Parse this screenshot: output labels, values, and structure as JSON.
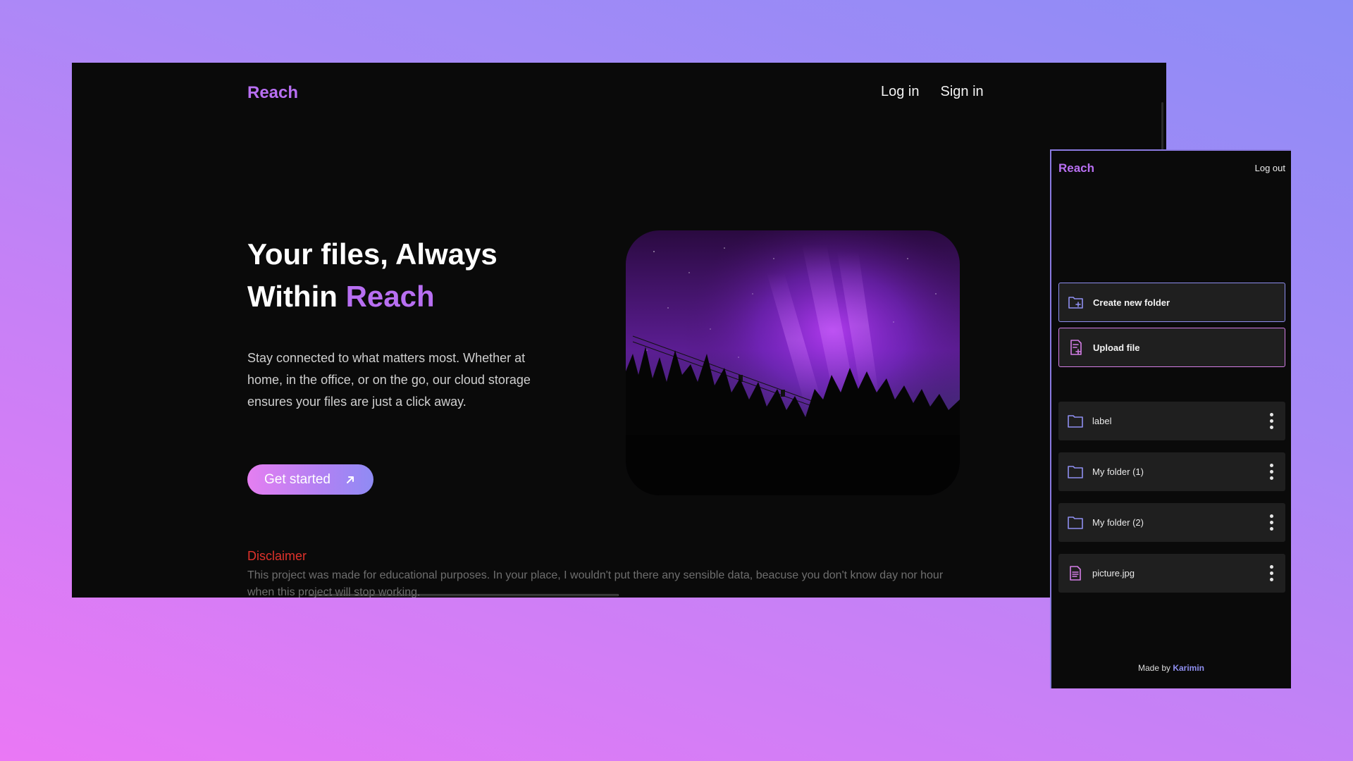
{
  "desktop": {
    "logo": "Reach",
    "nav": {
      "login": "Log in",
      "signin": "Sign in"
    },
    "hero": {
      "title_line1": "Your files, Always",
      "title_line2_prefix": "Within ",
      "title_line2_accent": "Reach",
      "text": "Stay connected to what matters most. Whether at home, in the office, or on the go, our cloud storage ensures your files are just a click away.",
      "cta_label": "Get started",
      "cta_icon": "arrow-up-right-icon"
    },
    "disclaimer": {
      "title": "Disclaimer",
      "text": "This project was made for educational purposes. In your place, I wouldn't put there any sensible data, beacuse you don't know day nor hour when this project will stop working."
    }
  },
  "mobile": {
    "logo": "Reach",
    "logout": "Log out",
    "actions": {
      "create": {
        "label": "Create new folder",
        "icon": "folder-plus-icon"
      },
      "upload": {
        "label": "Upload file",
        "icon": "file-plus-icon"
      }
    },
    "items": [
      {
        "name": "label",
        "type": "folder",
        "icon": "folder-icon"
      },
      {
        "name": "My folder (1)",
        "type": "folder",
        "icon": "folder-icon"
      },
      {
        "name": "My folder (2)",
        "type": "folder",
        "icon": "folder-icon"
      },
      {
        "name": "picture.jpg",
        "type": "file",
        "icon": "file-icon"
      }
    ],
    "footer": {
      "prefix": "Made by ",
      "author": "Karimin"
    }
  },
  "colors": {
    "accent": "#b86ff2",
    "accent_blue": "#8f8ff0",
    "accent_pink": "#d47ee6",
    "disclaimer": "#e0322b",
    "window_bg": "#0a0a0a"
  }
}
